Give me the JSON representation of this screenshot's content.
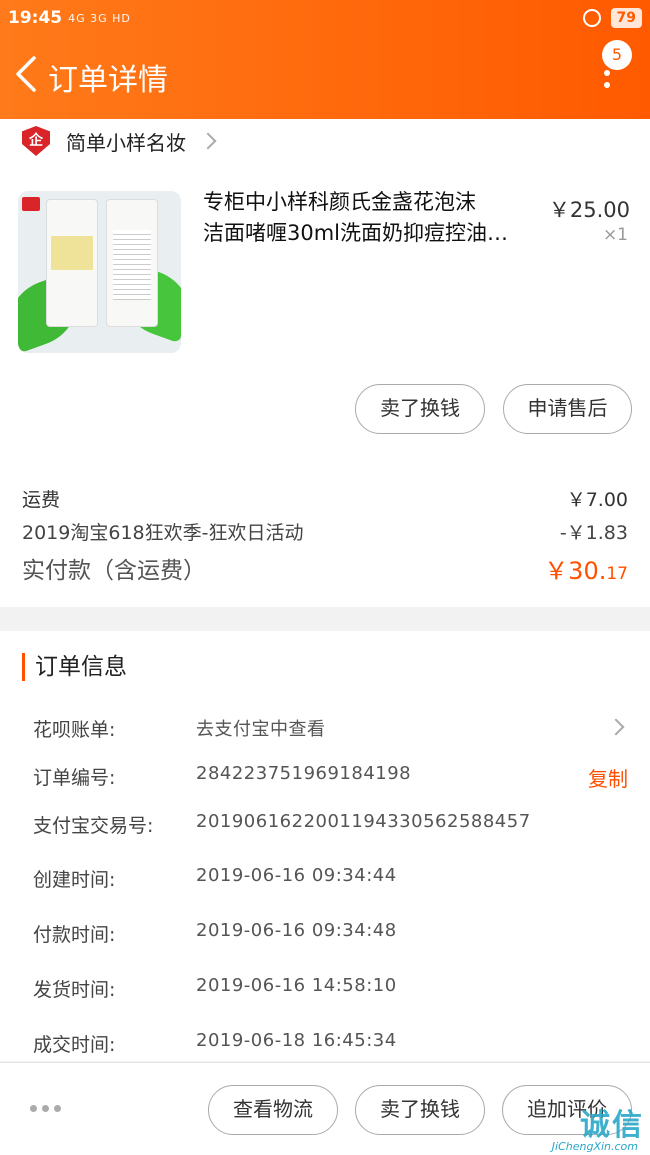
{
  "status_bar": {
    "time": "19:45",
    "signal": "4G 3G HD",
    "battery": "79"
  },
  "header": {
    "title": "订单详情",
    "badge_count": "5"
  },
  "shop": {
    "name": "简单小样名妆",
    "badge_char": "企"
  },
  "product": {
    "name_line1": "专柜中小样科颜氏金盏花泡沫",
    "name_line2": "洁面啫喱30ml洗面奶抑痘控油…",
    "price": "￥25.00",
    "qty": "×1"
  },
  "item_actions": {
    "sell": "卖了换钱",
    "after_sale": "申请售后"
  },
  "fees": {
    "shipping_label": "运费",
    "shipping_value": "￥7.00",
    "promo_label": "2019淘宝618狂欢季-狂欢日活动",
    "promo_value": "-￥1.83",
    "total_label": "实付款（含运费）",
    "total_int": "￥30.",
    "total_dec": "17"
  },
  "order_info": {
    "title": "订单信息",
    "rows": [
      {
        "label": "花呗账单:",
        "value": "去支付宝中查看"
      },
      {
        "label": "订单编号:",
        "value": "284223751969184198",
        "action": "复制"
      },
      {
        "label": "支付宝交易号:",
        "value": "2019061622001194330562588457"
      },
      {
        "label": "创建时间:",
        "value": "2019-06-16 09:34:44"
      },
      {
        "label": "付款时间:",
        "value": "2019-06-16 09:34:48"
      },
      {
        "label": "发货时间:",
        "value": "2019-06-16 14:58:10"
      },
      {
        "label": "成交时间:",
        "value": "2019-06-18 16:45:34"
      }
    ]
  },
  "bottom_bar": {
    "logistics": "查看物流",
    "sell": "卖了换钱",
    "review": "追加评价"
  },
  "watermark": {
    "text": "诚信",
    "url": "JiChengXin.com"
  },
  "colors": {
    "accent": "#ff5000",
    "header": "#ff6a0d"
  }
}
